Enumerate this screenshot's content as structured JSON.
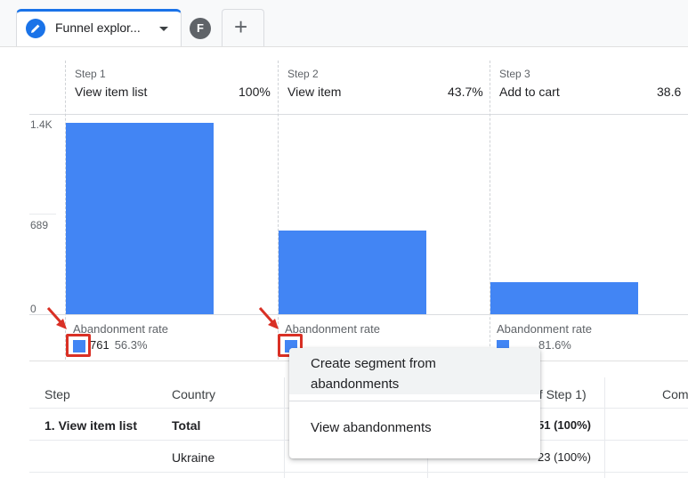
{
  "tabs": {
    "active_label": "Funnel explor...",
    "user_initial": "F",
    "add_label": "+"
  },
  "chart": {
    "steps": [
      {
        "num": "Step 1",
        "name": "View item list",
        "pct": "100%",
        "abandon_label": "Abandonment rate",
        "abandon_count": "761",
        "abandon_pct": "56.3%"
      },
      {
        "num": "Step 2",
        "name": "View item",
        "pct": "43.7%",
        "abandon_label": "Abandonment rate",
        "abandon_count": "",
        "abandon_pct": ""
      },
      {
        "num": "Step 3",
        "name": "Add to cart",
        "pct": "38.6",
        "abandon_label": "Abandonment rate",
        "abandon_count": "",
        "abandon_pct": "81.6%"
      }
    ],
    "yticks": [
      "1.4K",
      "689",
      "0"
    ]
  },
  "chart_data": {
    "type": "bar",
    "categories": [
      "View item list",
      "View item",
      "Add to cart"
    ],
    "values": [
      1351,
      590,
      228
    ],
    "ylim": [
      0,
      1400
    ],
    "grid": true
  },
  "table": {
    "headers": {
      "step": "Step",
      "country": "Country",
      "users": "of Step 1)",
      "com": "Com"
    },
    "rows": [
      {
        "step": "1. View item list",
        "country": "Total",
        "users": "51 (100%)"
      },
      {
        "step": "",
        "country": "Ukraine",
        "users": "23 (100%)"
      }
    ]
  },
  "menu": {
    "create_segment": "Create segment from abandonments",
    "view_abandonments": "View abandonments"
  },
  "colors": {
    "accent": "#1a73e8",
    "bar": "#4285f4",
    "highlight": "#d93025"
  }
}
